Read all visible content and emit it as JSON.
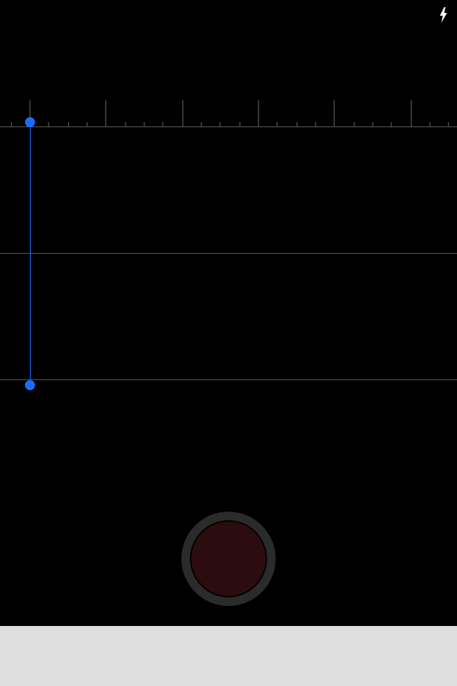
{
  "screen": {
    "name": "camera-measure-screen"
  },
  "toolbar": {
    "flash_icon": "lightning-bolt-icon"
  },
  "ruler": {
    "major_tick_count": 6,
    "minor_ticks_per_segment": 3
  },
  "measurement": {
    "start_handle_icon": "measure-handle-icon",
    "end_handle_icon": "measure-handle-icon"
  },
  "capture": {
    "shutter_button_icon": "shutter-button-icon"
  },
  "colors": {
    "background": "#000000",
    "measure_accent": "#1a6dff",
    "guide_line": "#5a5a5a",
    "ruler_tick": "#6e6e6e",
    "shutter_ring": "#2b2b2b",
    "shutter_core": "#2b0d0f",
    "bottom_panel": "#dedede"
  }
}
